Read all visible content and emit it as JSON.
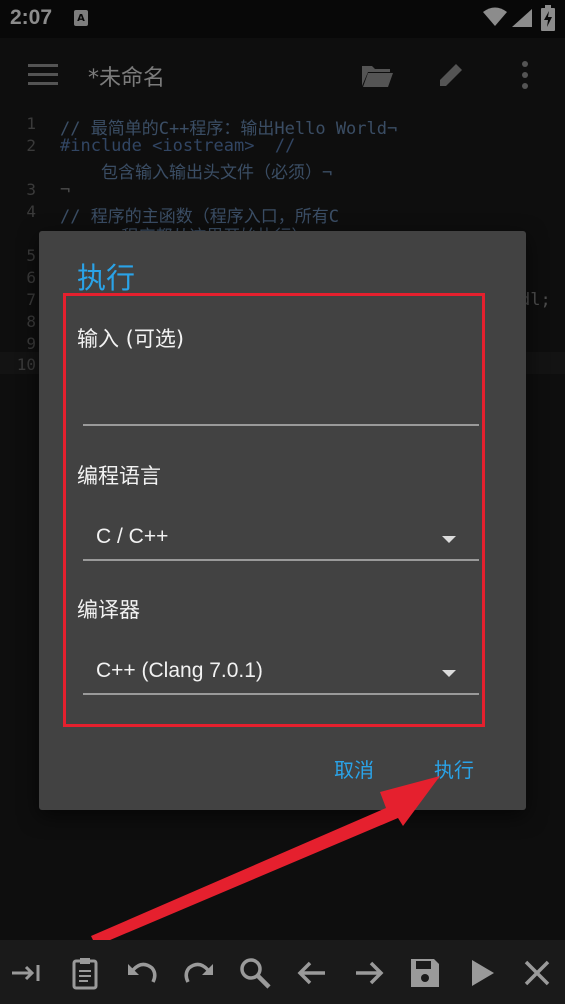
{
  "status": {
    "time": "2:07",
    "notif_letter": "A"
  },
  "appbar": {
    "title": "*未命名"
  },
  "editor": {
    "lines": [
      {
        "no": "1",
        "text": "// 最简单的C++程序：输出Hello World¬"
      },
      {
        "no": "2",
        "text": "#include <iostream>  //"
      },
      {
        "no": "",
        "text": "    包含输入输出头文件（必须）¬"
      },
      {
        "no": "3",
        "text": "¬"
      },
      {
        "no": "4",
        "text": "// 程序的主函数（程序入口，所有C"
      },
      {
        "no": "",
        "text": "    ++程序都从这里开始执行）"
      },
      {
        "no": "5",
        "text": ""
      },
      {
        "no": "6",
        "text": ""
      },
      {
        "no": "7",
        "text": ""
      },
      {
        "no": "8",
        "text": ""
      },
      {
        "no": "9",
        "text": ""
      },
      {
        "no": "10",
        "text": ""
      }
    ],
    "line7_tail": "dl;"
  },
  "dialog": {
    "title": "执行",
    "input_label": "输入 (可选)",
    "input_value": "",
    "language_label": "编程语言",
    "language_value": "C / C++",
    "compiler_label": "编译器",
    "compiler_value": "C++ (Clang 7.0.1)",
    "cancel_label": "取消",
    "run_label": "执行"
  },
  "colors": {
    "accent": "#2aa3e8",
    "highlight": "#e5202e",
    "dialog_bg": "#424242"
  },
  "toolbar": {
    "icons": [
      "tab-icon",
      "clipboard-icon",
      "undo-icon",
      "redo-icon",
      "search-icon",
      "arrow-left-icon",
      "arrow-right-icon",
      "save-icon",
      "play-icon",
      "close-icon"
    ]
  }
}
